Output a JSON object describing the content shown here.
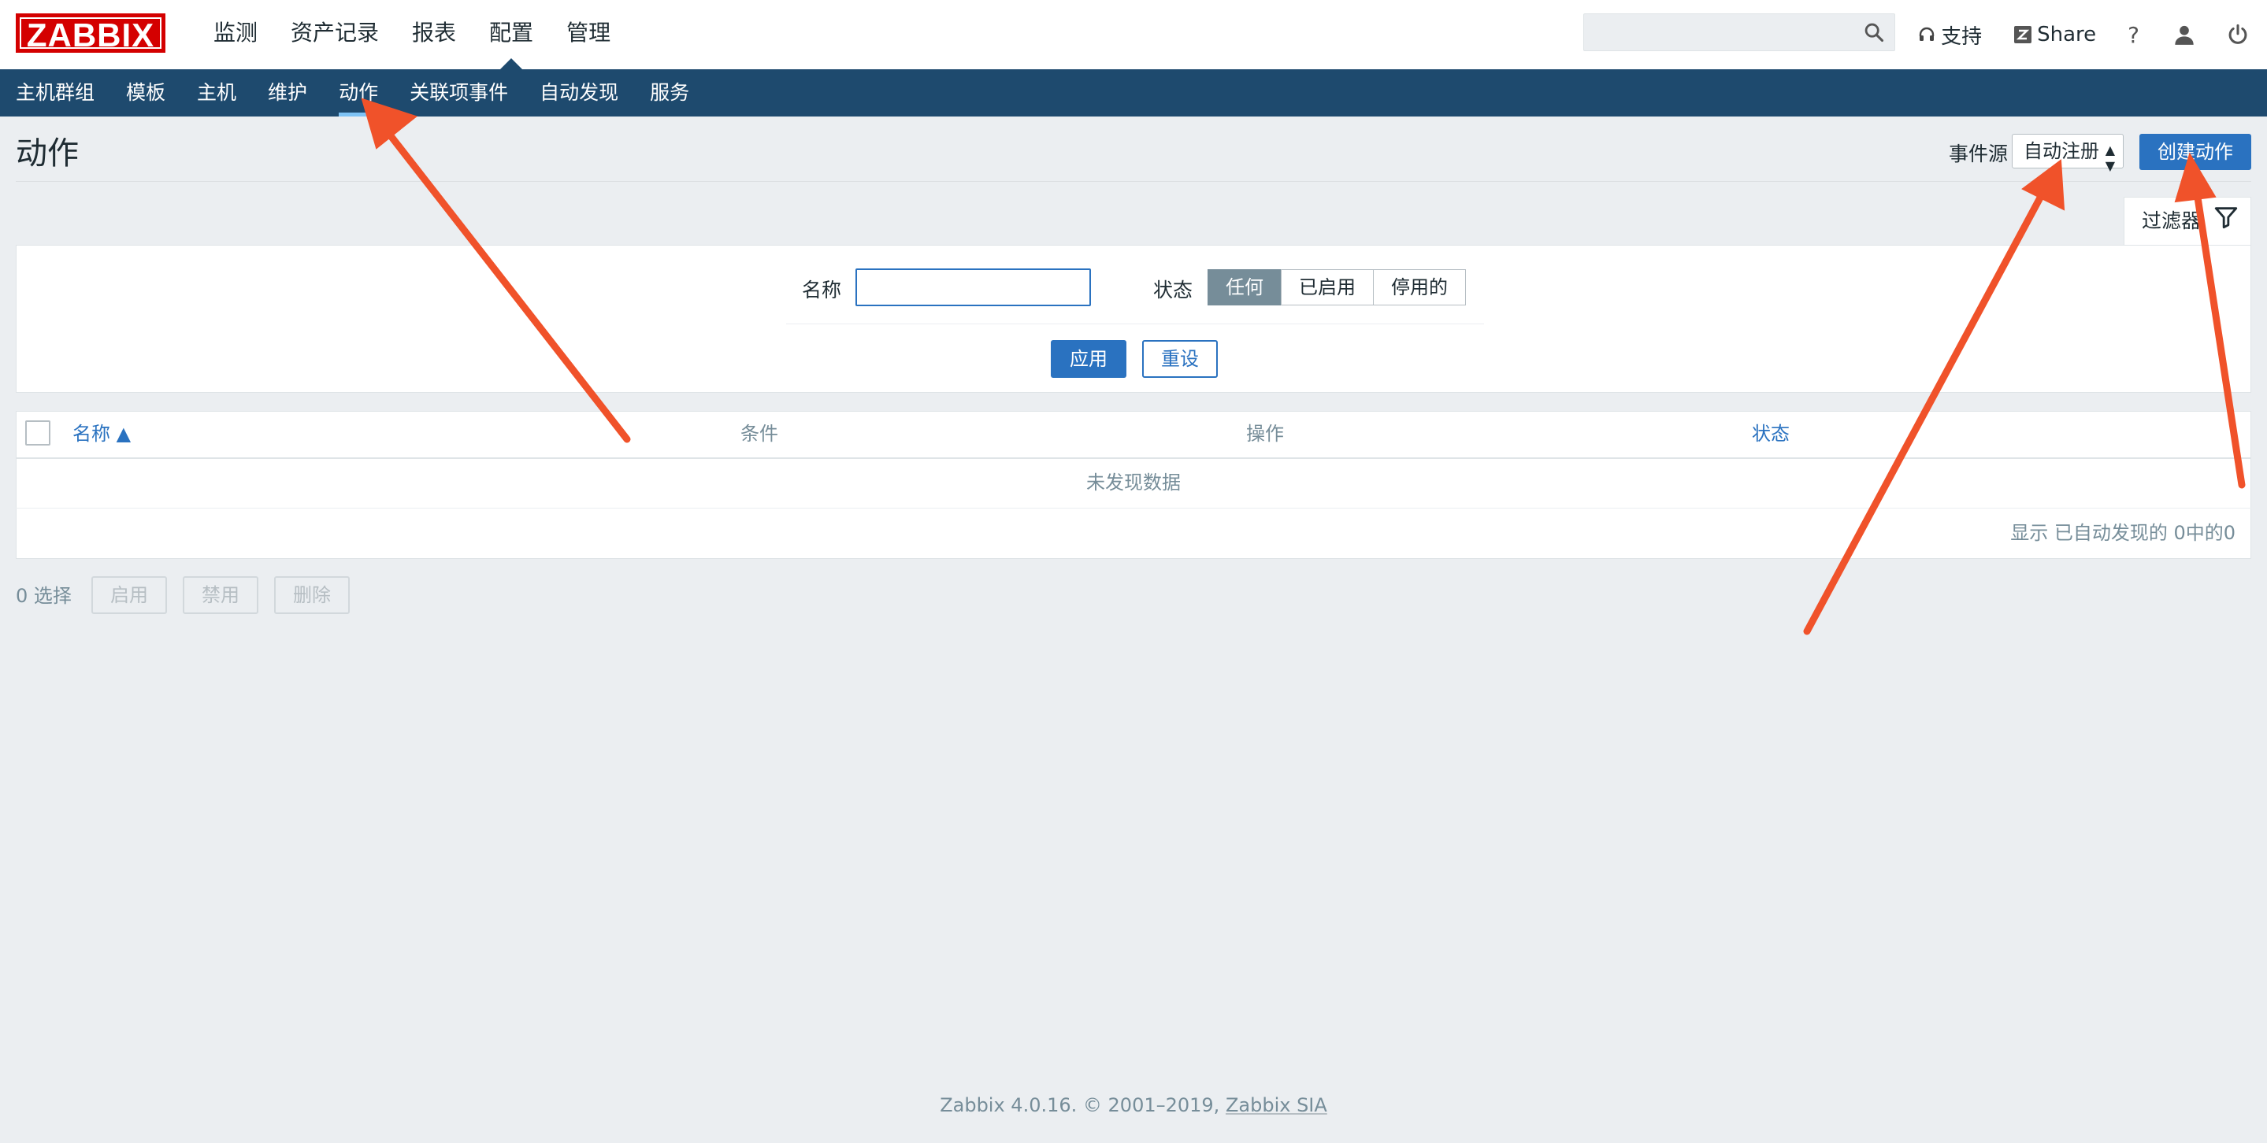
{
  "logo": "ZABBIX",
  "main_nav": [
    "监测",
    "资产记录",
    "报表",
    "配置",
    "管理"
  ],
  "main_nav_selected": "配置",
  "search": {
    "placeholder": ""
  },
  "top_links": {
    "support": "支持",
    "share": "Share",
    "help": "?"
  },
  "sub_nav": [
    "主机群组",
    "模板",
    "主机",
    "维护",
    "动作",
    "关联项事件",
    "自动发现",
    "服务"
  ],
  "sub_nav_selected": "动作",
  "page": {
    "title": "动作",
    "event_source_label": "事件源",
    "event_source_value": "自动注册",
    "create_button": "创建动作"
  },
  "filter": {
    "tab_label": "过滤器",
    "name_label": "名称",
    "name_value": "",
    "status_label": "状态",
    "status_options": [
      "任何",
      "已启用",
      "停用的"
    ],
    "status_selected": "任何",
    "apply": "应用",
    "reset": "重设"
  },
  "table": {
    "columns": [
      "名称 ▲",
      "条件",
      "操作",
      "状态"
    ],
    "no_data": "未发现数据",
    "paging_status": "显示 已自动发现的 0中的0"
  },
  "mass_actions": {
    "selected_count": "0 选择",
    "enable": "启用",
    "disable": "禁用",
    "delete": "删除"
  },
  "footer": {
    "text": "Zabbix 4.0.16. © 2001–2019,",
    "link": "Zabbix SIA"
  },
  "colors": {
    "header_bar": "#1e4a6e",
    "accent": "#2a72c0",
    "logo": "#d40000",
    "arrow": "#f0522a",
    "background": "#ebeef1"
  }
}
